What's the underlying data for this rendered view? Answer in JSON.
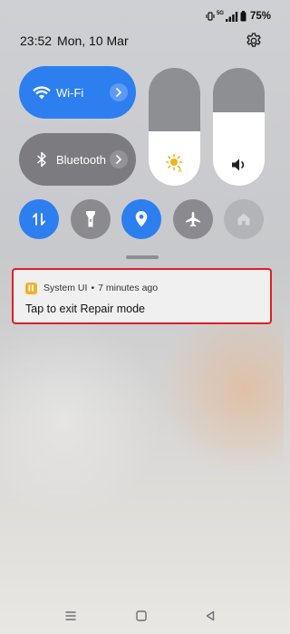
{
  "status_bar": {
    "signal_label": "5G",
    "battery": "75%"
  },
  "header": {
    "time": "23:52",
    "date": "Mon, 10 Mar"
  },
  "tiles": {
    "wifi": {
      "label": "Wi-Fi",
      "state": "on"
    },
    "bluetooth": {
      "label": "Bluetooth",
      "state": "off"
    }
  },
  "sliders": {
    "brightness": {
      "level": 0.46
    },
    "volume": {
      "level": 0.62
    }
  },
  "quick_toggles": [
    {
      "name": "mobile-data",
      "icon": "data-arrows-icon",
      "state": "on"
    },
    {
      "name": "flashlight",
      "icon": "flashlight-icon",
      "state": "off"
    },
    {
      "name": "location",
      "icon": "location-icon",
      "state": "on"
    },
    {
      "name": "airplane-mode",
      "icon": "airplane-icon",
      "state": "off"
    },
    {
      "name": "home",
      "icon": "home-icon",
      "state": "disabled"
    }
  ],
  "notification": {
    "app": "System UI",
    "separator": "•",
    "time": "7 minutes ago",
    "text": "Tap to exit Repair mode"
  },
  "colors": {
    "accent": "#2d7ff0",
    "highlight_border": "#e01f25",
    "app_icon": "#f2b12b"
  }
}
